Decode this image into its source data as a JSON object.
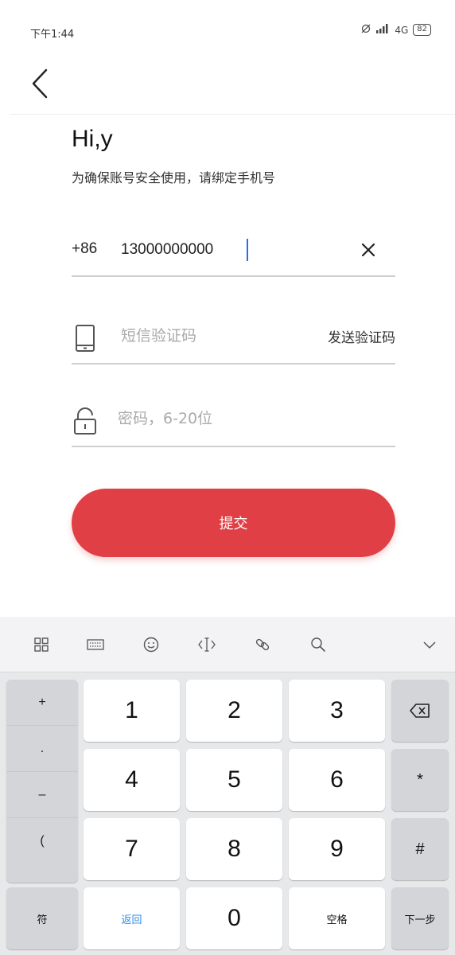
{
  "status_bar": {
    "time": "下午1:44",
    "network": "4G",
    "battery": "82"
  },
  "header": {
    "greeting": "Hi,y",
    "subtitle": "为确保账号安全使用，请绑定手机号"
  },
  "form": {
    "country_code": "+86",
    "phone_value": "13000000000",
    "sms_placeholder": "短信验证码",
    "send_code_label": "发送验证码",
    "password_placeholder": "密码，6-20位",
    "submit_label": "提交"
  },
  "keyboard": {
    "toolbar": [
      "apps-icon",
      "keyboard-icon",
      "emoji-icon",
      "cursor-icon",
      "link-icon",
      "search-icon",
      "collapse-icon"
    ],
    "symbols": [
      "+",
      ".",
      "–",
      "("
    ],
    "digits": [
      "1",
      "2",
      "3",
      "4",
      "5",
      "6",
      "7",
      "8",
      "9",
      "0"
    ],
    "right_keys": [
      "*",
      "#"
    ],
    "bottom": {
      "symbols": "符",
      "return": "返回",
      "space": "空格",
      "next": "下一步"
    }
  },
  "colors": {
    "accent": "#e04045",
    "caret": "#2a6fe0",
    "link": "#2b8de6"
  }
}
